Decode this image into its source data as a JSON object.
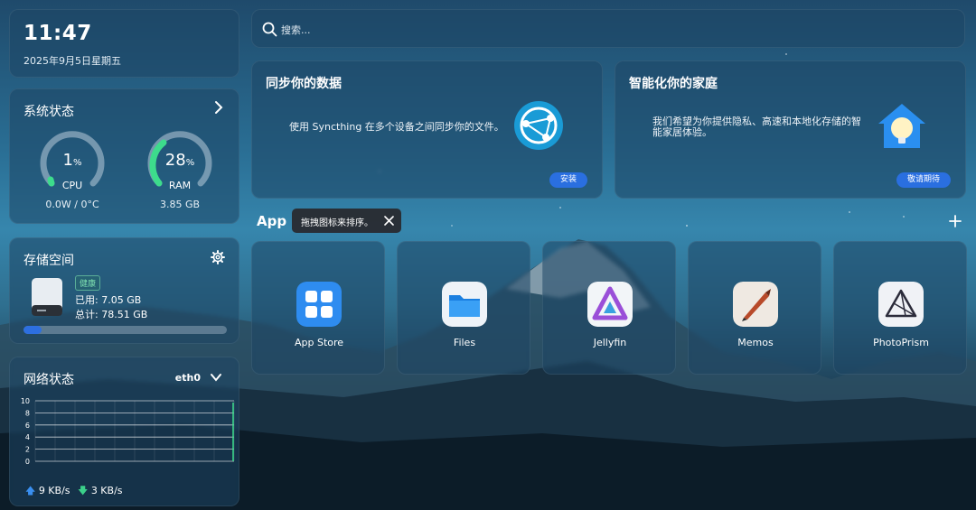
{
  "clock": {
    "time": "11:47",
    "date": "2025年9月5日星期五"
  },
  "system": {
    "title": "系统状态",
    "cpu": {
      "value": "1",
      "unit": "%",
      "label": "CPU",
      "sub": "0.0W / 0°C",
      "percent": 1
    },
    "ram": {
      "value": "28",
      "unit": "%",
      "label": "RAM",
      "sub": "3.85 GB",
      "percent": 28
    }
  },
  "storage": {
    "title": "存储空间",
    "badge": "健康",
    "used": "已用: 7.05 GB",
    "total": "总计: 78.51 GB",
    "fraction": 0.09
  },
  "network": {
    "title": "网络状态",
    "interface": "eth0",
    "upload": "9 KB/s",
    "download": "3 KB/s",
    "yticks": [
      "10",
      "8",
      "6",
      "4",
      "2",
      "0"
    ]
  },
  "search": {
    "placeholder": "搜索..."
  },
  "promos": {
    "sync": {
      "title": "同步你的数据",
      "desc": "使用 Syncthing 在多个设备之间同步你的文件。",
      "button": "安装"
    },
    "home": {
      "title": "智能化你的家庭",
      "desc_line1": "我们希望为你提供隐私、高速和本地化存储的智",
      "desc_line2": "能家居体验。",
      "button": "敬请期待"
    }
  },
  "apps": {
    "section_label": "App",
    "tooltip": "拖拽图标来排序。",
    "items": [
      {
        "name": "App Store",
        "icon": "app-store-icon"
      },
      {
        "name": "Files",
        "icon": "files-icon"
      },
      {
        "name": "Jellyfin",
        "icon": "jellyfin-icon"
      },
      {
        "name": "Memos",
        "icon": "memos-icon"
      },
      {
        "name": "PhotoPrism",
        "icon": "photoprism-icon"
      }
    ]
  },
  "colors": {
    "accent": "#2a6fe0",
    "gauge_green": "#3ddc8c",
    "healthy": "#7fe0b0"
  }
}
